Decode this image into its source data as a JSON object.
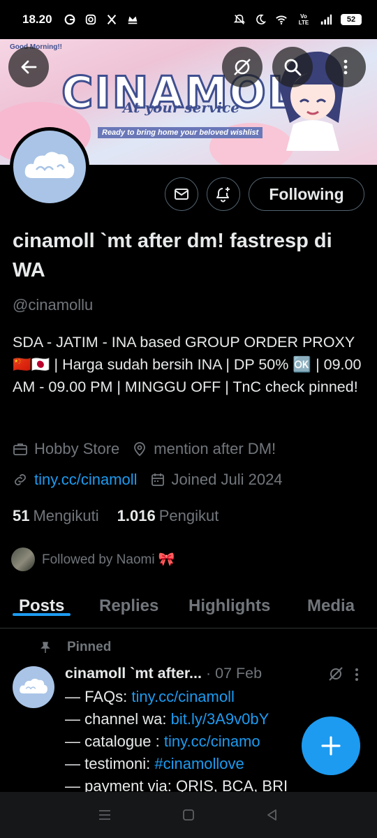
{
  "status_bar": {
    "time": "18.20",
    "network_label": "Vo\nLTE",
    "battery": "52",
    "left_icons": [
      "g-icon",
      "instagram-icon",
      "x-icon",
      "crown-icon"
    ],
    "right_icons": [
      "mute-icon",
      "moon-icon",
      "wifi-icon",
      "volte-icon",
      "signal-icon",
      "battery-icon"
    ]
  },
  "banner": {
    "title": "CINAMOLL",
    "subtitle": "At your service",
    "tagline": "Ready to bring home your beloved wishlist",
    "corner_text": "Good Morning!!"
  },
  "actions": {
    "following_label": "Following"
  },
  "profile": {
    "display_name": "cinamoll `mt after dm! fastresp di WA",
    "handle": "@cinamollu",
    "bio": "SDA - JATIM - INA based GROUP ORDER PROXY 🇨🇳🇯🇵 | Harga sudah bersih INA | DP 50% 🆗 | 09.00 AM - 09.00 PM | MINGGU OFF | TnC check pinned!",
    "category": "Hobby Store",
    "location": "mention after DM!",
    "website": "tiny.cc/cinamoll",
    "joined": "Joined Juli 2024",
    "following_count": "51",
    "following_label": "Mengikuti",
    "followers_count": "1.016",
    "followers_label": "Pengikut",
    "followed_by": "Followed by Naomi 🎀"
  },
  "tabs": [
    {
      "label": "Posts",
      "active": true
    },
    {
      "label": "Replies",
      "active": false
    },
    {
      "label": "Highlights",
      "active": false
    },
    {
      "label": "Media",
      "active": false
    }
  ],
  "pinned_tweet": {
    "pinned_label": "Pinned",
    "author": "cinamoll `mt after...",
    "separator": "·",
    "date": "07 Feb",
    "lines": [
      {
        "prefix": "— FAQs: ",
        "link": "tiny.cc/cinamoll"
      },
      {
        "prefix": "— channel wa: ",
        "link": "bit.ly/3A9v0bY"
      },
      {
        "prefix": "— catalogue : ",
        "link": "tiny.cc/cinamo"
      },
      {
        "prefix": "— testimoni: ",
        "link": "#cinamollove"
      },
      {
        "prefix": "— payment via: QRIS, BCA, BRI",
        "link": ""
      }
    ]
  },
  "colors": {
    "accent": "#1d9bf0",
    "secondary_text": "#71767b",
    "avatar_bg": "#a9c4e6"
  }
}
